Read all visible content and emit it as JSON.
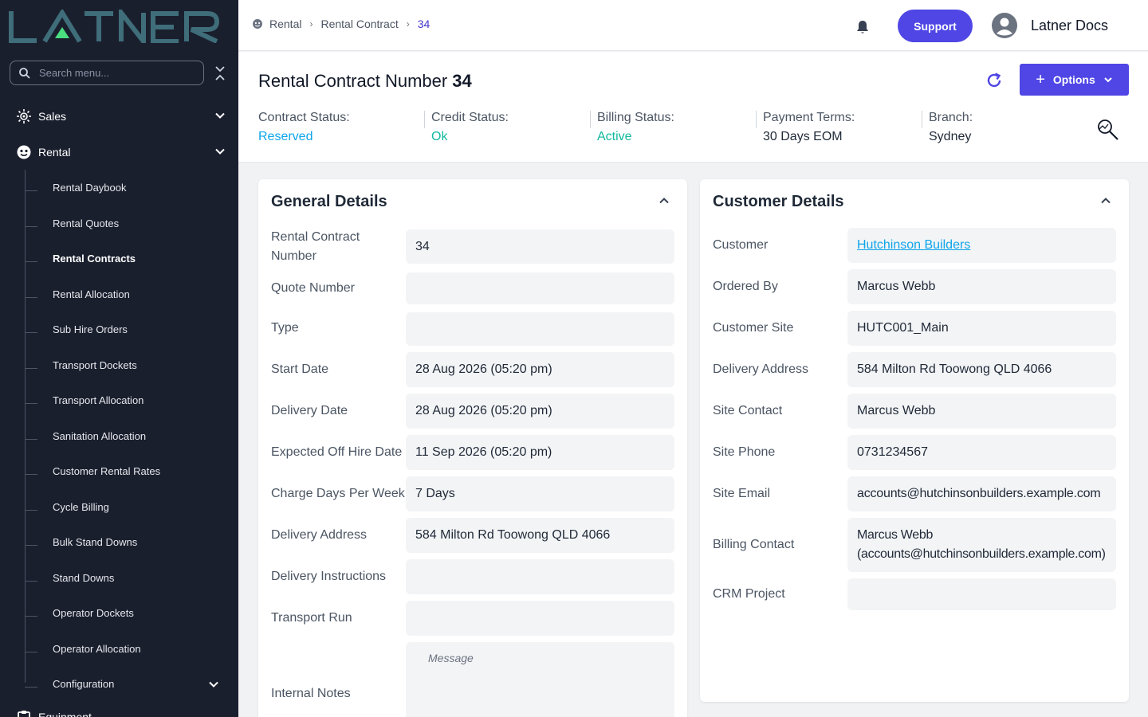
{
  "sidebar": {
    "logo_text": "LATNER",
    "search_placeholder": "Search menu...",
    "top_items": [
      {
        "label": "Sales",
        "icon": "sun-cog-icon"
      },
      {
        "label": "Rental",
        "icon": "face-icon"
      },
      {
        "label": "Equipment",
        "icon": "clipboard-icon"
      }
    ],
    "rental_items": [
      {
        "label": "Rental Daybook"
      },
      {
        "label": "Rental Quotes"
      },
      {
        "label": "Rental Contracts"
      },
      {
        "label": "Rental Allocation"
      },
      {
        "label": "Sub Hire Orders"
      },
      {
        "label": "Transport Dockets"
      },
      {
        "label": "Transport Allocation"
      },
      {
        "label": "Sanitation Allocation"
      },
      {
        "label": "Customer Rental Rates"
      },
      {
        "label": "Cycle Billing"
      },
      {
        "label": "Bulk Stand Downs"
      },
      {
        "label": "Stand Downs"
      },
      {
        "label": "Operator Dockets"
      },
      {
        "label": "Operator Allocation"
      },
      {
        "label": "Configuration"
      }
    ]
  },
  "topbar": {
    "breadcrumb": [
      "Rental",
      "Rental Contract",
      "34"
    ],
    "support_label": "Support",
    "user_name": "Latner Docs"
  },
  "header": {
    "title": "Rental Contract Number",
    "number": "34",
    "options_label": "Options",
    "statuses": [
      {
        "label": "Contract Status:",
        "value": "Reserved",
        "color": "#0ea5e9"
      },
      {
        "label": "Credit Status:",
        "value": "Ok",
        "color": "#10b9a0"
      },
      {
        "label": "Billing Status:",
        "value": "Active",
        "color": "#10b9a0"
      },
      {
        "label": "Payment Terms:",
        "value": "30 Days EOM",
        "color": "#1f2937"
      },
      {
        "label": "Branch:",
        "value": "Sydney",
        "color": "#1f2937"
      }
    ]
  },
  "general": {
    "title": "General Details",
    "rows": [
      {
        "label": "Rental Contract Number",
        "value": "34"
      },
      {
        "label": "Quote Number",
        "value": ""
      },
      {
        "label": "Type",
        "value": ""
      },
      {
        "label": "Start Date",
        "value": "28 Aug 2026 (05:20 pm)"
      },
      {
        "label": "Delivery Date",
        "value": "28 Aug 2026 (05:20 pm)"
      },
      {
        "label": "Expected Off Hire Date",
        "value": "11 Sep 2026 (05:20 pm)"
      },
      {
        "label": "Charge Days Per Week",
        "value": "7 Days"
      },
      {
        "label": "Delivery Address",
        "value": "584 Milton Rd Toowong QLD 4066"
      },
      {
        "label": "Delivery Instructions",
        "value": ""
      },
      {
        "label": "Transport Run",
        "value": ""
      },
      {
        "label": "Internal Notes",
        "placeholder": "Message"
      }
    ]
  },
  "customer": {
    "title": "Customer Details",
    "rows": [
      {
        "label": "Customer",
        "value": "Hutchinson Builders"
      },
      {
        "label": "Ordered By",
        "value": "Marcus Webb"
      },
      {
        "label": "Customer Site",
        "value": "HUTC001_Main"
      },
      {
        "label": "Delivery Address",
        "value": "584 Milton Rd Toowong QLD 4066"
      },
      {
        "label": "Site Contact",
        "value": "Marcus Webb"
      },
      {
        "label": "Site Phone",
        "value": "0731234567"
      },
      {
        "label": "Site Email",
        "value": "accounts@hutchinsonbuilders.example.com"
      },
      {
        "label": "Billing Contact",
        "value_line1": "Marcus Webb",
        "value_line2": "(accounts@hutchinsonbuilders.example.com)"
      },
      {
        "label": "CRM Project",
        "value": ""
      }
    ]
  },
  "colors": {
    "sidebar_bg": "#1a1f2e",
    "accent": "#4f46e5",
    "link_blue": "#0ea5e9",
    "status_green": "#10b9a0"
  }
}
